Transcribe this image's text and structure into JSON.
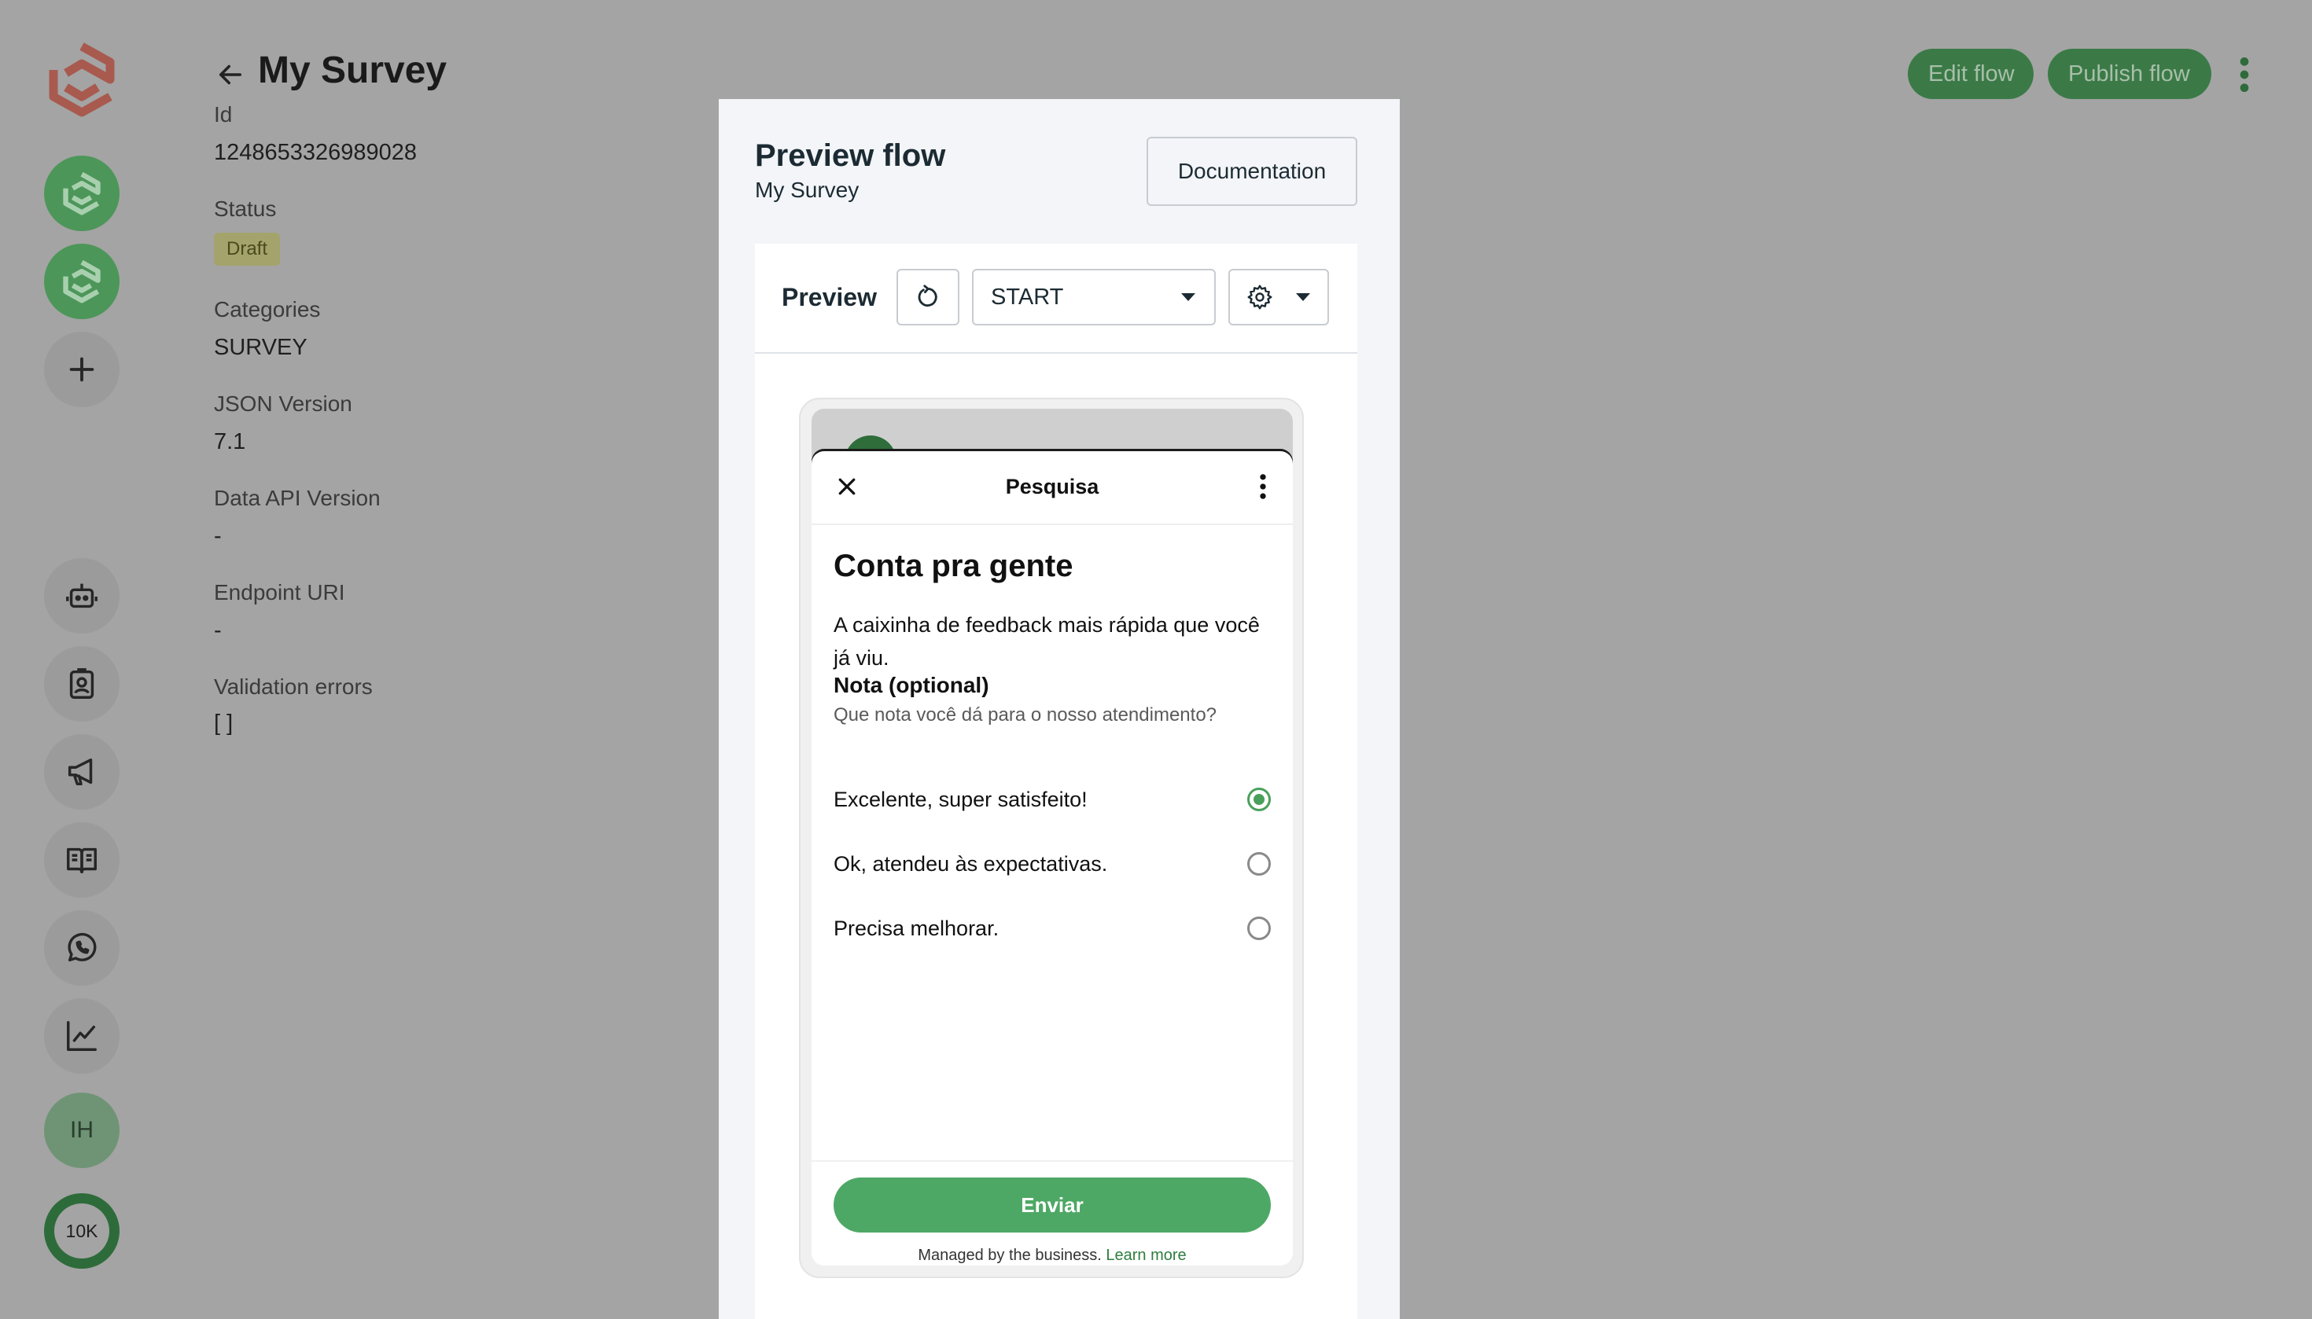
{
  "header": {
    "title": "My Survey",
    "edit_label": "Edit flow",
    "publish_label": "Publish flow"
  },
  "details": {
    "id_label": "Id",
    "id_value": "1248653326989028",
    "status_label": "Status",
    "status_value": "Draft",
    "categories_label": "Categories",
    "categories_value": "SURVEY",
    "json_label": "JSON Version",
    "json_value": "7.1",
    "data_api_label": "Data API Version",
    "data_api_value": "-",
    "endpoint_label": "Endpoint URI",
    "endpoint_value": "-",
    "errors_label": "Validation errors",
    "errors_value": "[ ]"
  },
  "rail": {
    "avatar_initials": "IH",
    "quota_label": "10K"
  },
  "modal": {
    "title": "Preview flow",
    "subtitle": "My Survey",
    "doc_label": "Documentation",
    "toolbar": {
      "label": "Preview",
      "screen_value": "START"
    }
  },
  "phone": {
    "sheet_title": "Pesquisa",
    "heading": "Conta pra gente",
    "body": "A caixinha de feedback mais rápida que você já viu.",
    "field_label": "Nota (optional)",
    "field_help": "Que nota você dá para o nosso atendimento?",
    "options": [
      {
        "label": "Excelente, super satisfeito!",
        "selected": true
      },
      {
        "label": "Ok, atendeu às expectativas.",
        "selected": false
      },
      {
        "label": "Precisa melhorar.",
        "selected": false
      }
    ],
    "submit_label": "Enviar",
    "footer_text": "Managed by the business.",
    "footer_link": "Learn more"
  },
  "colors": {
    "backdrop": "#a4a4a4",
    "header_button": "#3b7a47",
    "submit": "#4ea865",
    "radio_selected": "#4aa05b"
  },
  "icons": {
    "rail": [
      "app-logo-icon",
      "whatsapp-account-icon",
      "whatsapp-account-icon",
      "plus-icon",
      "bot-icon",
      "contact-card-icon",
      "megaphone-icon",
      "book-icon",
      "whatsapp-icon",
      "chart-icon"
    ],
    "header": [
      "arrow-left-icon",
      "more-vertical-icon"
    ],
    "toolbar": [
      "refresh-icon",
      "caret-down-icon",
      "gear-icon"
    ],
    "sheet": [
      "close-icon",
      "more-vertical-icon"
    ]
  }
}
